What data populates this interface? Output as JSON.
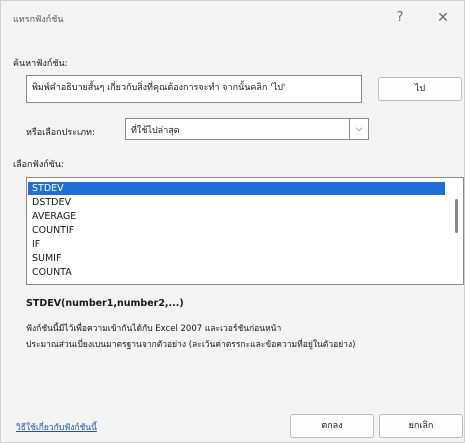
{
  "window": {
    "title": "แทรกฟังก์ชัน",
    "help_glyph": "?",
    "close_glyph": "✕"
  },
  "search": {
    "label": "ค้นหาฟังก์ชัน:",
    "description_value": "พิมพ์คำอธิบายสั้นๆ เกี่ยวกับสิ่งที่คุณต้องการจะทำ จากนั้นคลิก 'ไป'",
    "go_label": "ไป"
  },
  "category": {
    "label": "หรือเลือกประเภท:",
    "selected": "ที่ใช้ไปล่าสุด",
    "arrow": "⌵"
  },
  "functions": {
    "label": "เลือกฟังก์ชัน:",
    "items": [
      "STDEV",
      "DSTDEV",
      "AVERAGE",
      "COUNTIF",
      "IF",
      "SUMIF",
      "COUNTA"
    ],
    "selected_index": 0
  },
  "details": {
    "syntax": "STDEV(number1,number2,...)",
    "line1": "ฟังก์ชันนี้มีไว้เพื่อความเข้ากันได้กับ Excel 2007 และเวอร์ชันก่อนหน้า",
    "line2": "ประมาณส่วนเบี่ยงเบนมาตรฐานจากตัวอย่าง (ละเว้นค่าตรรกะและข้อความที่อยู่ในตัวอย่าง)"
  },
  "footer": {
    "help_link": "วิธีใช้เกี่ยวกับฟังก์ชันนี้",
    "ok_label": "ตกลง",
    "cancel_label": "ยกเลิก"
  },
  "colors": {
    "selection": "#1e6fd9",
    "link": "#1a56b8",
    "dialog_bg": "#f3f3f3"
  }
}
